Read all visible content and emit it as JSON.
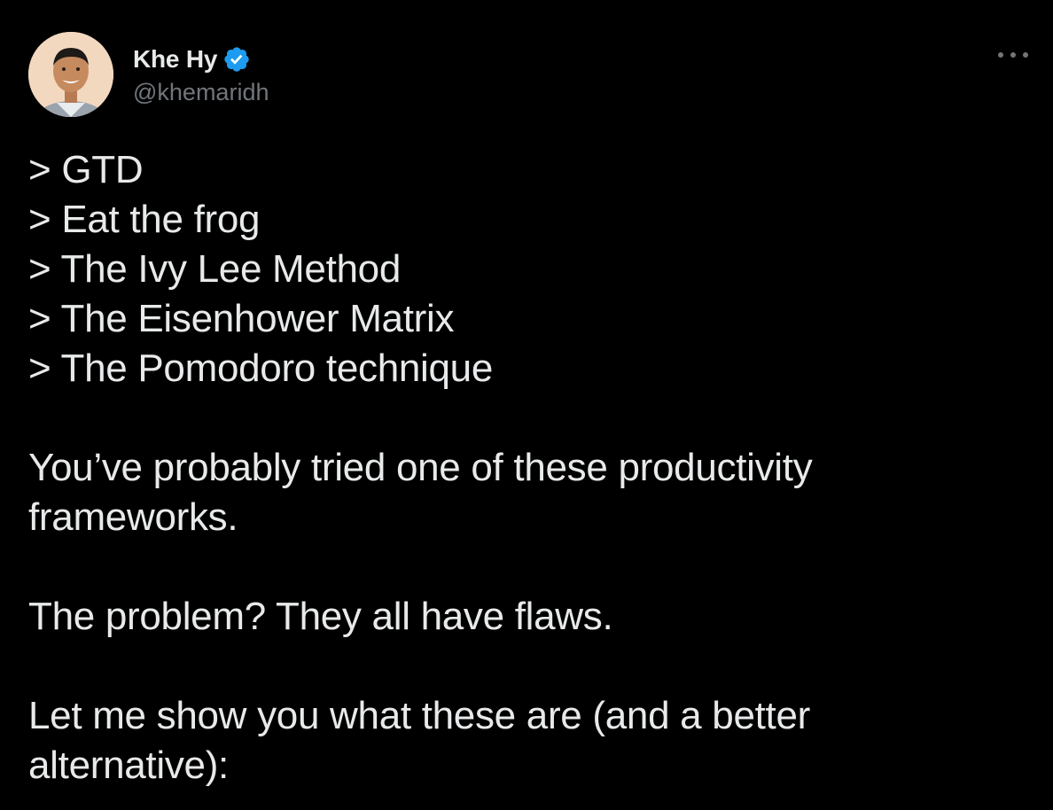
{
  "author": {
    "display_name": "Khe Hy",
    "handle": "@khemaridh",
    "verified": true
  },
  "icons": {
    "verified": "verified-badge-icon",
    "more": "more-options-icon",
    "verified_color": "#1d9bf0"
  },
  "tweet": {
    "list": [
      "> GTD",
      "> Eat the frog",
      "> The Ivy Lee Method",
      "> The Eisenhower Matrix",
      "> The Pomodoro technique"
    ],
    "para1_line1": "You’ve probably tried one of these productivity",
    "para1_line2": "frameworks.",
    "para2": "The problem? They all have flaws.",
    "para3_line1": "Let me show you what these are (and a better",
    "para3_line2": "alternative):"
  }
}
